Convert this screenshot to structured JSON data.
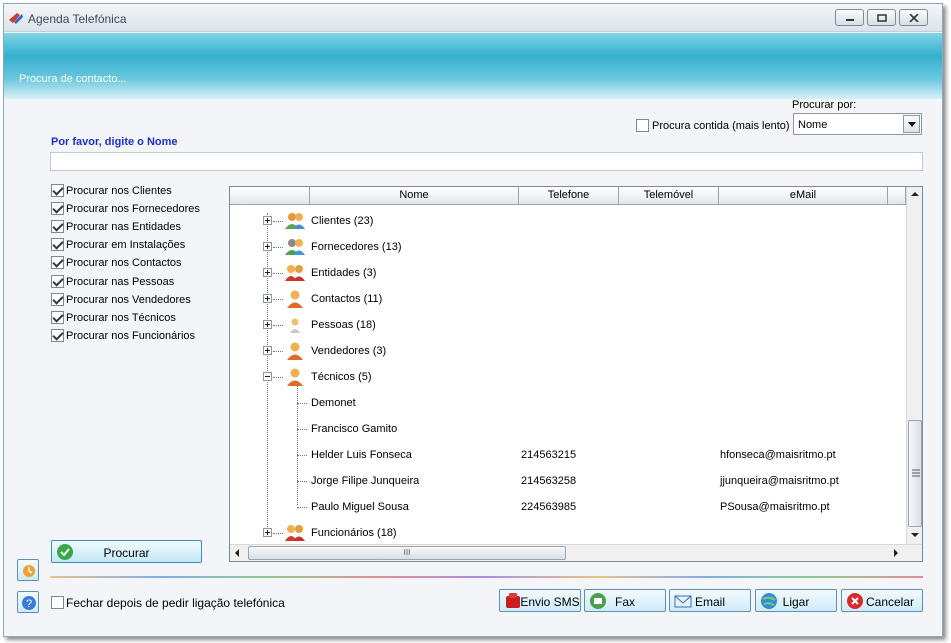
{
  "window": {
    "title": "Agenda Telefónica"
  },
  "banner": {
    "text": "Procura de contacto..."
  },
  "search": {
    "procurar_por_label": "Procurar por:",
    "contida_label": "Procura contida (mais lento)",
    "contida_checked": false,
    "procurar_por_value": "Nome",
    "prompt": "Por favor, digite o Nome",
    "name_value": ""
  },
  "options": [
    {
      "label": "Procurar nos Clientes",
      "checked": true
    },
    {
      "label": "Procurar nos Fornecedores",
      "checked": true
    },
    {
      "label": "Procurar nas Entidades",
      "checked": true
    },
    {
      "label": "Procurar em Instalações",
      "checked": true
    },
    {
      "label": "Procurar nos Contactos",
      "checked": true
    },
    {
      "label": "Procurar nas Pessoas",
      "checked": true
    },
    {
      "label": "Procurar nos Vendedores",
      "checked": true
    },
    {
      "label": "Procurar nos Técnicos",
      "checked": true
    },
    {
      "label": "Procurar nos Funcionários",
      "checked": true
    }
  ],
  "grid": {
    "columns": [
      "Nome",
      "Telefone",
      "Telemóvel",
      "eMail"
    ],
    "groups": [
      {
        "label": "Clientes (23)",
        "icon": "people-group-icon",
        "expanded": false
      },
      {
        "label": "Fornecedores (13)",
        "icon": "people-group-icon",
        "expanded": false
      },
      {
        "label": "Entidades (3)",
        "icon": "entity-group-icon",
        "expanded": false
      },
      {
        "label": "Contactos (11)",
        "icon": "person-icon",
        "expanded": false
      },
      {
        "label": "Pessoas (18)",
        "icon": "small-person-icon",
        "expanded": false
      },
      {
        "label": "Vendedores (3)",
        "icon": "person-icon",
        "expanded": false
      },
      {
        "label": "Técnicos (5)",
        "icon": "person-icon",
        "expanded": true,
        "children": [
          {
            "nome": "Demonet",
            "telefone": "",
            "telemovel": "",
            "email": ""
          },
          {
            "nome": "Francisco Gamito",
            "telefone": "",
            "telemovel": "",
            "email": ""
          },
          {
            "nome": "Helder Luis Fonseca",
            "telefone": "214563215",
            "telemovel": "",
            "email": "hfonseca@maisritmo.pt"
          },
          {
            "nome": "Jorge Filipe Junqueira",
            "telefone": "214563258",
            "telemovel": "",
            "email": "jjunqueira@maisritmo.pt"
          },
          {
            "nome": "Paulo Miguel Sousa",
            "telefone": "224563985",
            "telemovel": "",
            "email": "PSousa@maisritmo.pt"
          }
        ]
      },
      {
        "label": "Funcionários (18)",
        "icon": "entity-group-icon",
        "expanded": false
      }
    ],
    "hscroll_grip": "III"
  },
  "buttons": {
    "procurar": "Procurar",
    "envio_sms": "Envio SMS",
    "fax": "Fax",
    "email": "Email",
    "ligar": "Ligar",
    "cancelar": "Cancelar"
  },
  "footer": {
    "fechar_label": "Fechar depois de pedir ligação telefónica",
    "fechar_checked": false
  }
}
